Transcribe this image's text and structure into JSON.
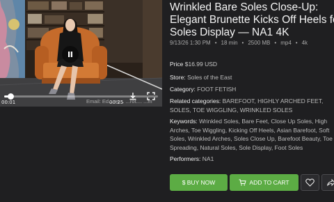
{
  "player": {
    "current_time": "00:01",
    "duration": "00:25",
    "progress": 0.04,
    "watermark": "Email: Ed... ec... ...rot.... ...m"
  },
  "product": {
    "title_lines": [
      "Wrinkled Bare Soles Close-Up:",
      "Elegant Brunette Kicks Off Heels for",
      "Soles Display — NA1 4K"
    ],
    "meta": {
      "date": "9/13/26 1:30 PM",
      "length": "18 min",
      "size": "2500 MB",
      "format": "mp4",
      "quality": "4k"
    },
    "price_label": "Price",
    "price_value": "$16.99 USD",
    "store_label": "Store:",
    "store_value": "Soles of the East",
    "category_label": "Category:",
    "category_value": "FOOT FETISH",
    "related_label": "Related categories:",
    "related_lines": [
      "BAREFOOT, HIGHLY ARCHED FEET,",
      "SOLES, TOE WIGGLING, WRINKLED SOLES"
    ],
    "keywords_label": "Keywords:",
    "keywords_lines": [
      "Wrinkled Soles, Bare Feet, Close Up Soles, High",
      "Arches, Toe Wiggling, Kicking Off Heels, Asian Barefoot, Soft",
      "Soles, Wrinkled Arches, Soles Close Up, Barefoot Beauty, Toe",
      "Spreading, Natural Soles, Sole Display, Foot Soles"
    ],
    "performers_label": "Performers:",
    "performers_value": "NA1"
  },
  "actions": {
    "buy_now": "$ BUY NOW",
    "add_to_cart": "ADD TO CART"
  },
  "colors": {
    "background": "#1f1f21",
    "accent_green": "#5cac44"
  },
  "icons": [
    "play-pause-icon",
    "download-icon",
    "fullscreen-icon",
    "cart-icon",
    "heart-icon",
    "share-icon"
  ]
}
